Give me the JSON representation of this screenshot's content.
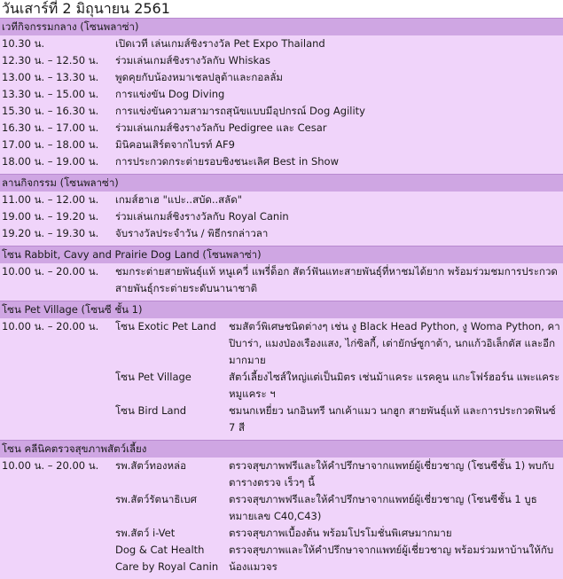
{
  "title": "วันเสาร์ที่ 2 มิถุนายน 2561",
  "sections": [
    {
      "header": "เวทีกิจกรรมกลาง (โซนพลาซ่า)",
      "rows": [
        {
          "time": "10.30 น.",
          "event": "เปิดเวที เล่นเกมส์ชิงรางวัล Pet Expo Thailand"
        },
        {
          "time": "12.30 น. – 12.50 น.",
          "event": "ร่วมเล่นเกมส์ชิงรางวัลกับ Whiskas"
        },
        {
          "time": "13.00 น. – 13.30 น.",
          "event": "พูดคุยกับน้องหมาเชลปลูต้าและกอลลั่ม"
        },
        {
          "time": "13.30 น. – 15.00 น.",
          "event": "การแข่งขัน Dog Diving"
        },
        {
          "time": "15.30 น. – 16.30 น.",
          "event": "การแข่งขันความสามารถสุนัขแบบมีอุปกรณ์ Dog Agility"
        },
        {
          "time": "16.30 น. – 17.00 น.",
          "event": "ร่วมเล่นเกมส์ชิงรางวัลกับ Pedigree และ Cesar"
        },
        {
          "time": "17.00 น. – 18.00 น.",
          "event": "มินิคอนเสิร์ตจากไบรท์ AF9"
        },
        {
          "time": "18.00 น. – 19.00 น.",
          "event": "การประกวดกระต่ายรอบชิงชนะเลิศ Best in Show"
        }
      ]
    },
    {
      "header": "ลานกิจกรรม (โซนพลาซ่า)",
      "rows": [
        {
          "time": "11.00 น. – 12.00 น.",
          "event": "เกมส์ฮาเฮ \"แปะ..สบัด..สลัด\""
        },
        {
          "time": "19.00 น. – 19.20 น.",
          "event": "ร่วมเล่นเกมส์ชิงรางวัลกับ Royal Canin"
        },
        {
          "time": "19.20 น. – 19.30 น.",
          "event": "จับรางวัลประจำวัน / พิธีกรกล่าวลา"
        }
      ]
    },
    {
      "header": "โซน Rabbit, Cavy and Prairie Dog Land (โซนพลาซ่า)",
      "rows": [
        {
          "time": "10.00 น. – 20.00 น.",
          "event": "ชมกระต่ายสายพันธุ์แท้ หนูเควี่ แพรี่ด็อก สัตว์ฟันแทะสายพันธุ์ที่หาชมได้ยาก พร้อมร่วมชมการประกวดสายพันธุ์กระต่ายระดับนานาชาติ"
        }
      ]
    },
    {
      "header": "โซน Pet Village (โซนซี ชั้น 1)",
      "rows": [
        {
          "time": "10.00 น. – 20.00 น.",
          "zone": "โซน Exotic Pet Land",
          "event": "ชมสัตว์พิเศษชนิดต่างๆ เช่น งู Black Head Python, งู Woma Python, คาปิบาร่า, แมงป่องเรืองแสง, ไก่ซิลกี้, เต่ายักษ์ซูกาต้า, นกแก้วอิเล็กตัส และอีกมากมาย"
        },
        {
          "time": "",
          "zone": "โซน Pet Village",
          "event": "สัตว์เลี้ยงไซส์ใหญ่แต่เป็นมิตร เช่นม้าแคระ แรคคูน แกะโฟร์ฮอร์น แพะแคระ หมูแคระ ฯ"
        },
        {
          "time": "",
          "zone": "โซน Bird Land",
          "event": "ชมนกเหยี่ยว นกอินทรี นกเค้าแมว นกฮูก สายพันธุ์แท้ และการประกวดฟินซ์ 7 สี"
        }
      ]
    },
    {
      "header": "โซน คลีนิคตรวจสุขภาพสัตว์เลี้ยง",
      "rows": [
        {
          "time": "10.00 น. – 20.00 น.",
          "zone": "รพ.สัตว์ทองหล่อ",
          "event": "ตรวจสุขภาพฟรีและให้คำปรึกษาจากแพทย์ผู้เชี่ยวชาญ (โซนซีชั้น 1) พบกับตารางตรวจ เร็วๆ นี้"
        },
        {
          "time": "",
          "zone": "รพ.สัตว์รัตนาธิเบศ",
          "event": "ตรวจสุขภาพฟรีและให้คำปรึกษาจากแพทย์ผู้เชี่ยวชาญ (โซนซีชั้น 1 บูธหมายเลข C40,C43)"
        },
        {
          "time": "",
          "zone": "รพ.สัตว์ i-Vet",
          "event": "ตรวจสุขภาพเบื้องต้น พร้อมโปรโมชั่นพิเศษมากมาย"
        },
        {
          "time": "",
          "zone": "Dog & Cat Health Care by Royal Canin",
          "event": "ตรวจสุขภาพและให้คำปรึกษาจากแพทย์ผู้เชี่ยวชาญ พร้อมร่วมหาบ้านให้กับน้องแมวจร"
        }
      ]
    }
  ]
}
